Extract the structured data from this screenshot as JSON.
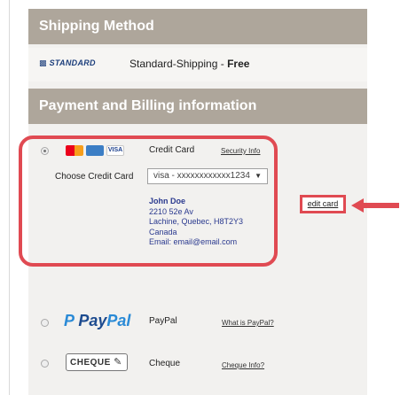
{
  "shipping": {
    "header": "Shipping Method",
    "carrier_badge": "STANDARD",
    "method_name": "Standard-Shipping - ",
    "method_price": "Free"
  },
  "payment": {
    "header": "Payment and Billing information",
    "credit_card": {
      "label": "Credit Card",
      "security_link": "Security Info",
      "choose_label": "Choose Credit Card",
      "visa_icon_text": "VISA",
      "selected_card": "visa - xxxxxxxxxxxx1234",
      "address": {
        "name": "John Doe",
        "street": "2210 52e Av",
        "city": "Lachine, Quebec, H8T2Y3",
        "country": "Canada",
        "email": "Email: email@email.com"
      },
      "edit_link": "edit card"
    },
    "paypal": {
      "logo_text_a": "Pay",
      "logo_text_b": "Pal",
      "label": "PayPal",
      "info_link": "What is PayPal?"
    },
    "cheque": {
      "logo_text": "CHEQUE",
      "label": "Cheque",
      "info_link": "Cheque Info?"
    }
  },
  "colors": {
    "header_bg": "#aea69b",
    "highlight": "#e04a52",
    "address_text": "#2b3a8f"
  }
}
